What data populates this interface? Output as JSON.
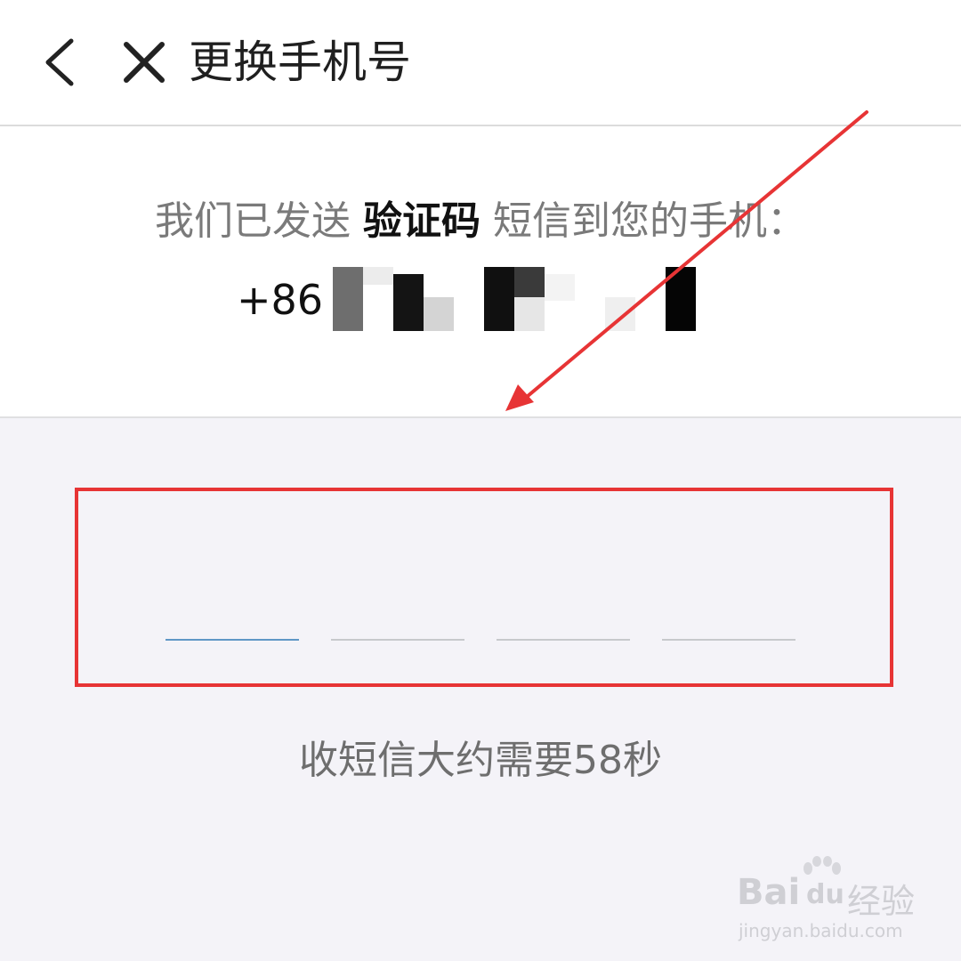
{
  "header": {
    "back_icon": "chevron-left-icon",
    "close_icon": "close-icon",
    "title": "更换手机号"
  },
  "info": {
    "sent_prefix": "我们已发送",
    "sent_highlight": "验证码",
    "sent_suffix": "短信到您的手机：",
    "country_code": "+86"
  },
  "code_input": {
    "slots": 4,
    "active_slot": 1
  },
  "hint": "收短信大约需要58秒",
  "watermark": {
    "brand": "Bai",
    "brand_suffix": "du",
    "service": "经验",
    "url": "jingyan.baidu.com"
  },
  "colors": {
    "accent": "#e73435",
    "active_underline": "#5f97c6",
    "background": "#f4f3f8"
  }
}
